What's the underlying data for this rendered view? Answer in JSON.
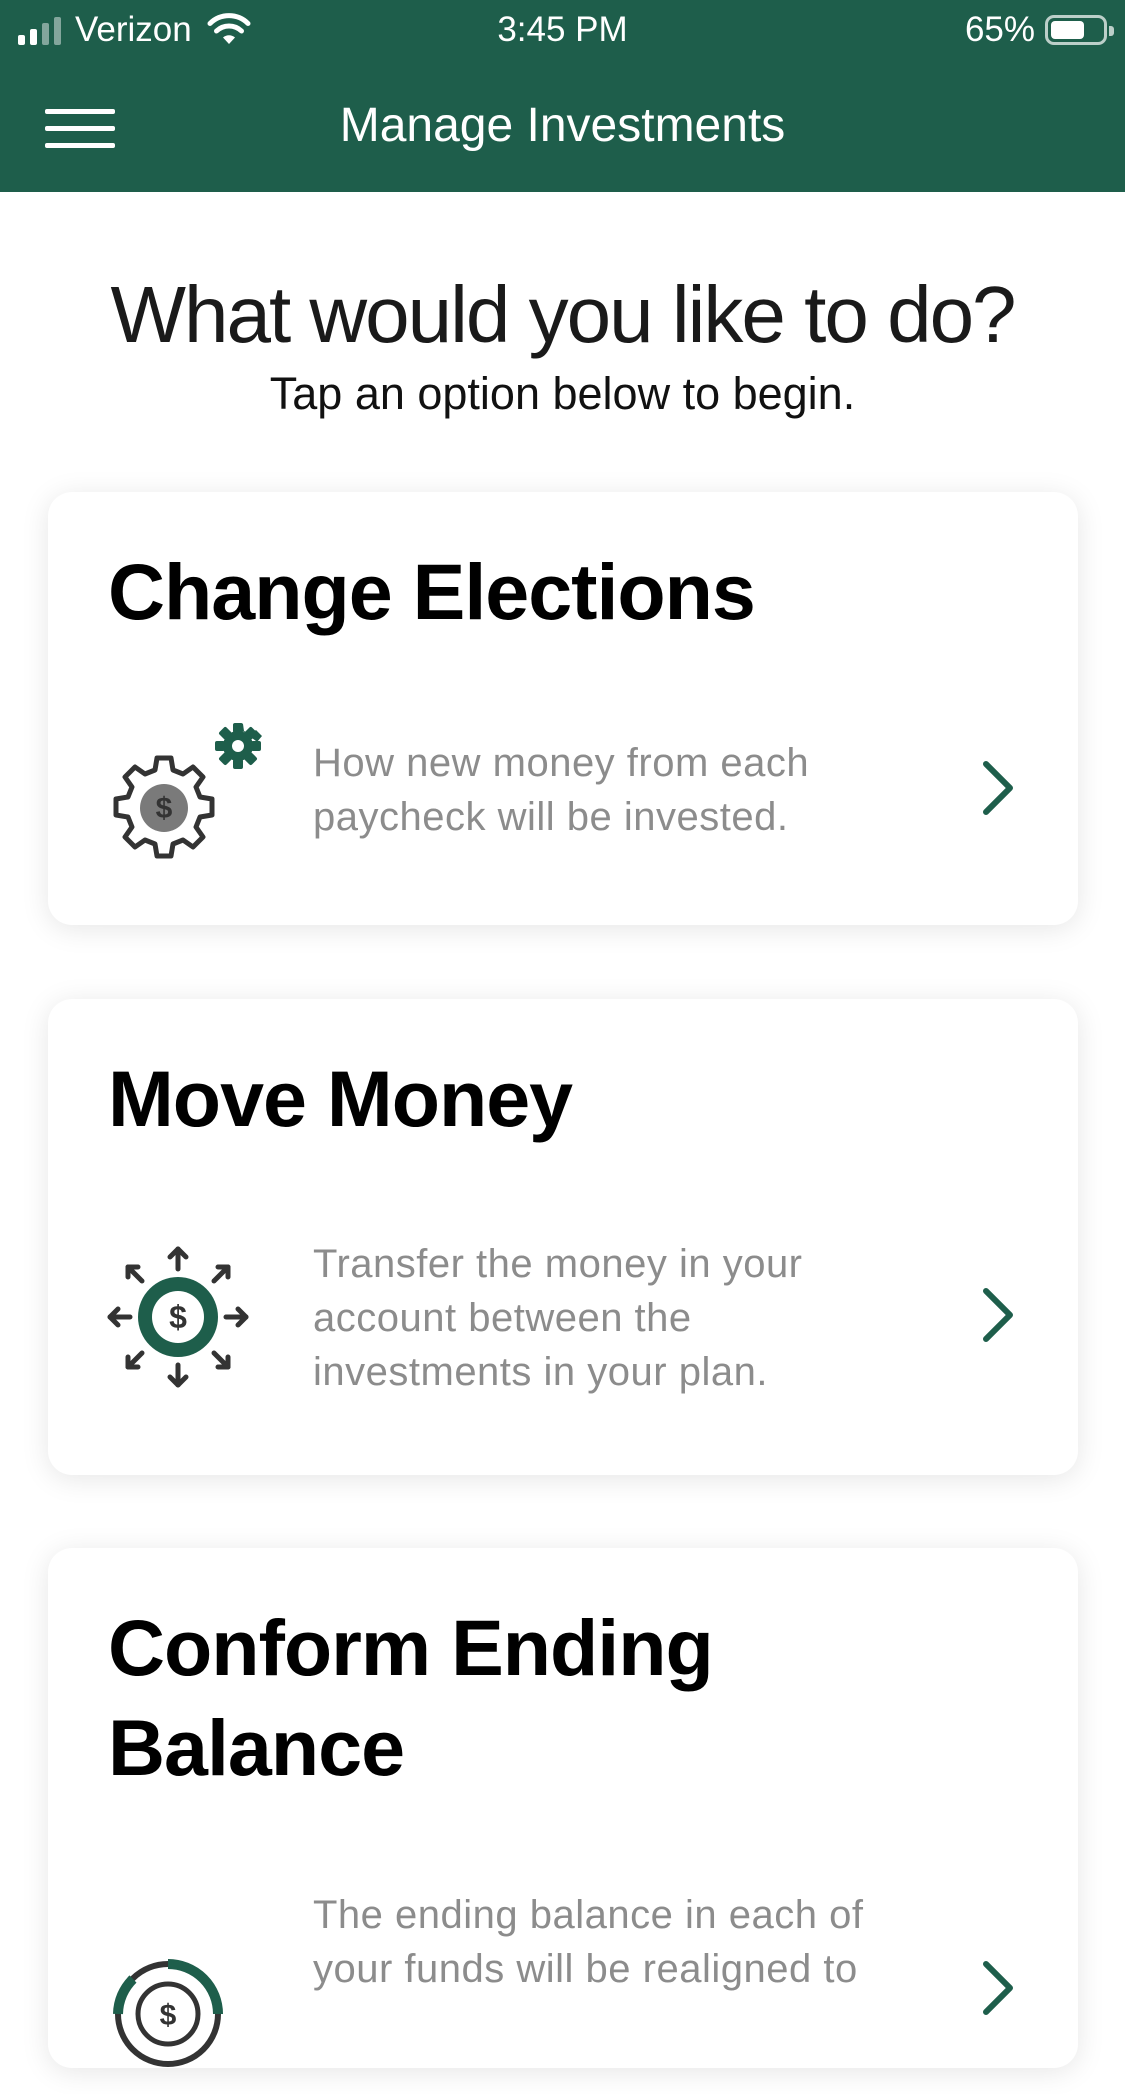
{
  "status_bar": {
    "carrier": "Verizon",
    "time": "3:45 PM",
    "battery_text": "65%",
    "battery_level": 0.65,
    "signal_bars": 2,
    "signal_bars_total": 4
  },
  "nav": {
    "title": "Manage Investments",
    "menu_icon": "hamburger-menu-icon"
  },
  "intro": {
    "heading": "What would you like to do?",
    "subheading": "Tap an option below to begin."
  },
  "options": [
    {
      "title": "Change Elections",
      "description": "How new money from each paycheck will be invested.",
      "icon": "gear-dollar-icon"
    },
    {
      "title": "Move Money",
      "description": "Transfer the money in your account between the investments in your plan.",
      "icon": "move-money-arrows-icon"
    },
    {
      "title": "Conform Ending Balance",
      "description": "The ending balance in each of your funds will be realigned to",
      "icon": "balance-dial-icon"
    }
  ],
  "colors": {
    "brand_green": "#1e5e4b",
    "description_gray": "#8c8c8c",
    "icon_dark": "#333333"
  }
}
